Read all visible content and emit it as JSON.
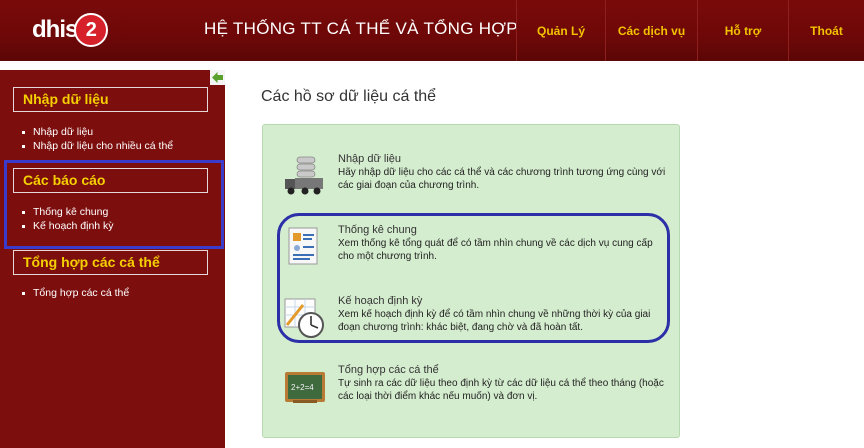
{
  "header": {
    "logo_text": "dhis",
    "logo_number": "2",
    "app_title": "HỆ THỐNG TT CÁ THỂ VÀ TỔNG HỢP",
    "nav": [
      {
        "label": "Quản Lý"
      },
      {
        "label": "Các dịch vụ"
      },
      {
        "label": "Hỗ trợ"
      },
      {
        "label": "Thoát"
      }
    ]
  },
  "sidebar": {
    "sections": [
      {
        "title": "Nhập dữ liệu",
        "items": [
          "Nhập dữ liệu",
          "Nhập dữ liệu cho nhiều cá thể"
        ]
      },
      {
        "title": "Các báo cáo",
        "items": [
          "Thống kê chung",
          "Kế hoạch định kỳ"
        ]
      },
      {
        "title": "Tổng hợp các cá thể",
        "items": [
          "Tổng hợp các cá thể"
        ]
      }
    ]
  },
  "main": {
    "title": "Các hồ sơ dữ liệu cá thể",
    "entries": [
      {
        "title": "Nhập dữ liệu",
        "description": "Hãy nhập dữ liệu cho các cá thể và các chương trình tương ứng cùng với các giai đoạn của chương trình.",
        "icon": "truck-database-icon"
      },
      {
        "title": "Thống kê chung",
        "description": "Xem thống kê tổng quát để có tầm nhìn chung về các dịch vụ cung cấp cho một chương trình.",
        "icon": "report-document-icon"
      },
      {
        "title": "Kế hoạch định kỳ",
        "description": "Xem kế hoạch định kỳ để có tầm nhìn chung về những thời kỳ của giai đoạn chương trình: khác biệt, đang chờ và đã hoàn tất.",
        "icon": "schedule-clock-icon"
      },
      {
        "title": "Tổng hợp các cá thể",
        "description": "Tự sinh ra các dữ liệu theo định kỳ từ các dữ liệu cá thể theo tháng (hoặc các loại thời điểm khác nếu muốn) và đơn vị.",
        "icon": "chalkboard-icon"
      }
    ]
  },
  "colors": {
    "header_bg": "#6e0808",
    "sidebar_bg": "#7d0e0e",
    "nav_text": "#f2c200",
    "section_title": "#f5d000",
    "panel_bg": "#d5edcf",
    "annotation": "#3a3acb"
  }
}
